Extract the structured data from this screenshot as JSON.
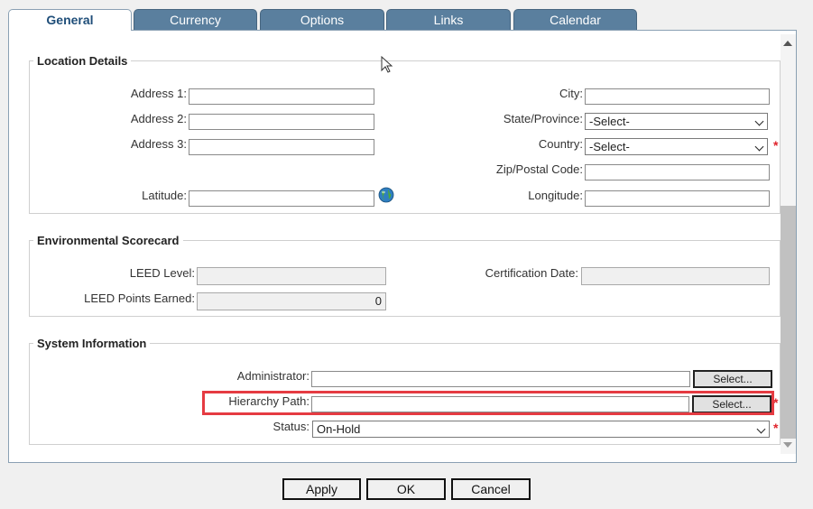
{
  "tabs": [
    {
      "label": "General",
      "active": true
    },
    {
      "label": "Currency",
      "active": false
    },
    {
      "label": "Options",
      "active": false
    },
    {
      "label": "Links",
      "active": false
    },
    {
      "label": "Calendar",
      "active": false
    }
  ],
  "location": {
    "legend": "Location Details",
    "address1_label": "Address 1:",
    "address2_label": "Address 2:",
    "address3_label": "Address 3:",
    "latitude_label": "Latitude:",
    "city_label": "City:",
    "state_label": "State/Province:",
    "state_value": "-Select-",
    "country_label": "Country:",
    "country_value": "-Select-",
    "zip_label": "Zip/Postal Code:",
    "longitude_label": "Longitude:"
  },
  "environment": {
    "legend": "Environmental Scorecard",
    "leed_level_label": "LEED Level:",
    "leed_points_label": "LEED Points Earned:",
    "leed_points_value": "0",
    "cert_date_label": "Certification Date:"
  },
  "system": {
    "legend": "System Information",
    "admin_label": "Administrator:",
    "admin_select": "Select...",
    "hierarchy_label": "Hierarchy Path:",
    "hierarchy_select": "Select...",
    "status_label": "Status:",
    "status_value": "On-Hold"
  },
  "required_mark": "*",
  "buttons": {
    "apply": "Apply",
    "ok": "OK",
    "cancel": "Cancel"
  },
  "colors": {
    "tab_bg": "#5a7f9e",
    "active_tab_text": "#1f4e79",
    "required": "#e0242c",
    "highlight": "#e53b42"
  }
}
